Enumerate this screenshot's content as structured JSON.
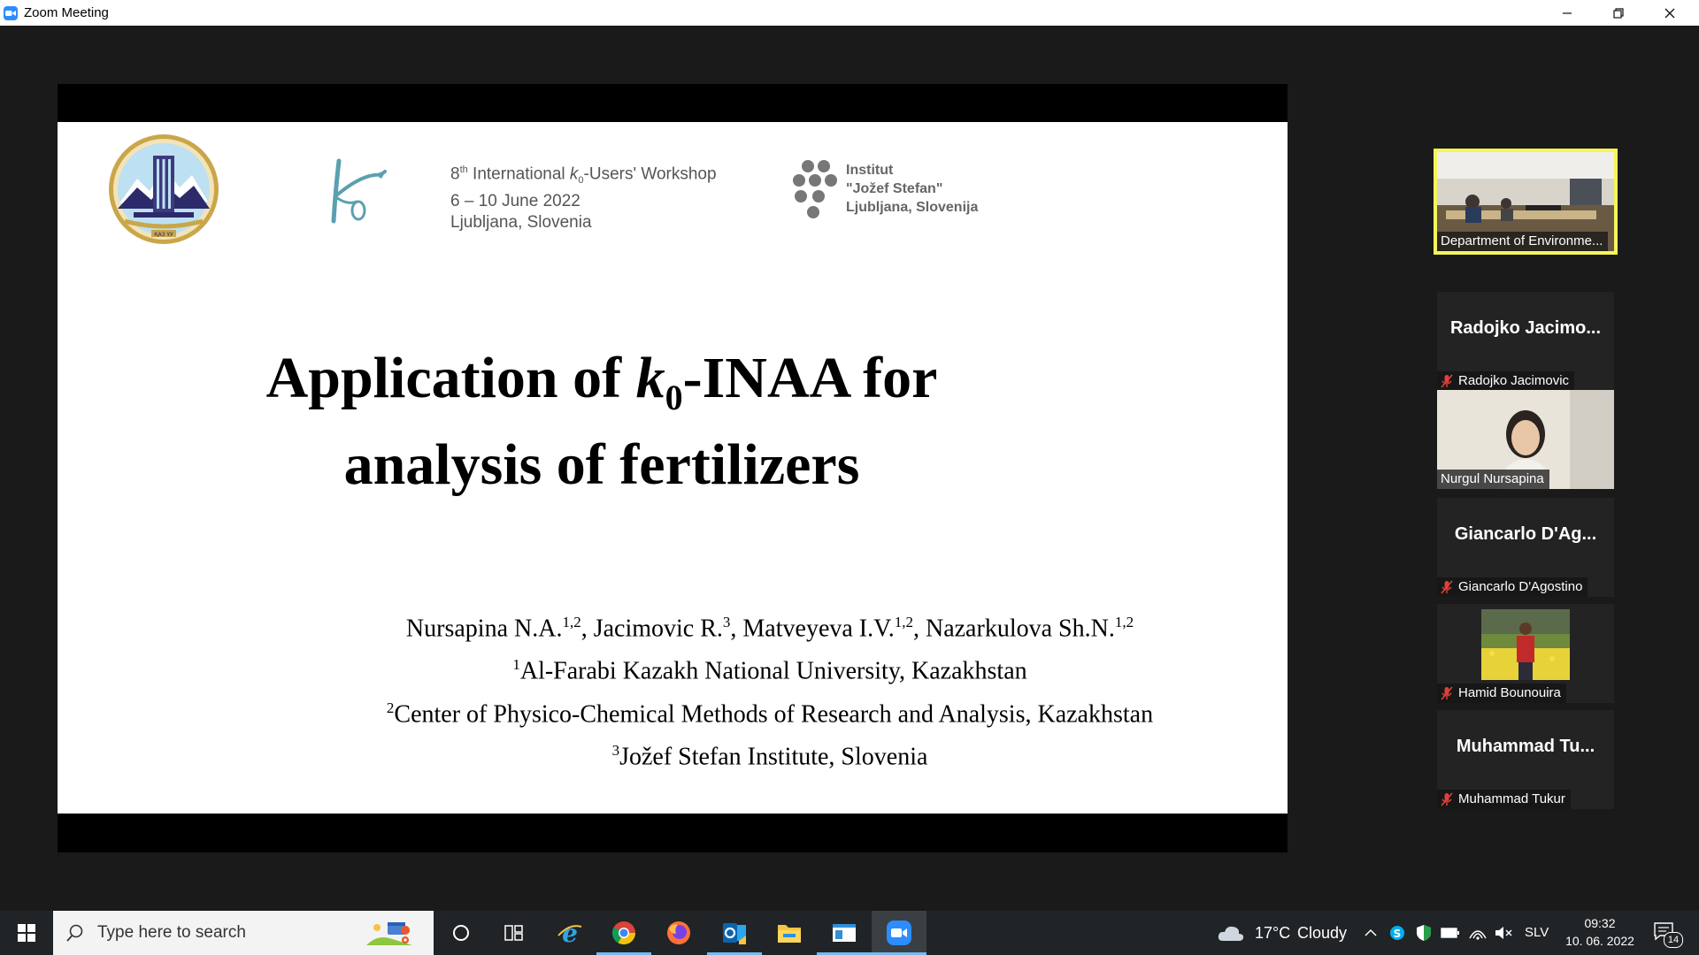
{
  "window": {
    "title": "Zoom Meeting"
  },
  "slide": {
    "workshop": {
      "line1_pre": "8",
      "line1_sup": "th",
      "line1_mid": " International ",
      "line1_k": "k",
      "line1_sub": "0",
      "line1_post": "-Users' Workshop",
      "line2": "6 – 10 June 2022",
      "line3": "Ljubljana, Slovenia"
    },
    "institute": {
      "line1": "Institut",
      "line2": "\"Jožef Stefan\"",
      "line3": "Ljubljana, Slovenija"
    },
    "uni_logo_text": "ҚАЗ ҰУ",
    "title": {
      "pre": "Application of ",
      "k": "k",
      "sub": "0",
      "post": "-INAA for",
      "line2": "analysis of fertilizers"
    },
    "authors": {
      "a1": "Nursapina N.A.",
      "a1_sup": "1,2",
      "a2": ", Jacimovic R.",
      "a2_sup": "3",
      "a3": ", Matveyeva I.V.",
      "a3_sup": "1,2",
      "a4": ", Nazarkulova Sh.N.",
      "a4_sup": "1,2"
    },
    "affiliations": [
      {
        "sup": "1",
        "text": "Al-Farabi Kazakh National University, Kazakhstan"
      },
      {
        "sup": "2",
        "text": "Center of Physico-Chemical Methods of Research and Analysis, Kazakhstan"
      },
      {
        "sup": "3",
        "text": "Jožef Stefan Institute, Slovenia"
      }
    ]
  },
  "participants": [
    {
      "label": "Department of Environme...",
      "active": true
    },
    {
      "big": "Radojko  Jacimo...",
      "label": "Radojko Jacimovic",
      "muted": true
    },
    {
      "label": "Nurgul Nursapina"
    },
    {
      "big": "Giancarlo  D'Ag...",
      "label": "Giancarlo D'Agostino",
      "muted": true
    },
    {
      "label": "Hamid Bounouira",
      "muted": true
    },
    {
      "big": "Muhammad  Tu...",
      "label": "Muhammad Tukur",
      "muted": true
    }
  ],
  "taskbar": {
    "search_placeholder": "Type here to search",
    "weather_temp": "17°C",
    "weather_desc": "Cloudy",
    "language": "SLV",
    "time": "09:32",
    "date": "10. 06. 2022",
    "notification_count": "14"
  },
  "colors": {
    "active_speaker_border": "#f5f55a",
    "muted_icon": "#e0403a",
    "zoom_blue": "#2d8cff"
  }
}
